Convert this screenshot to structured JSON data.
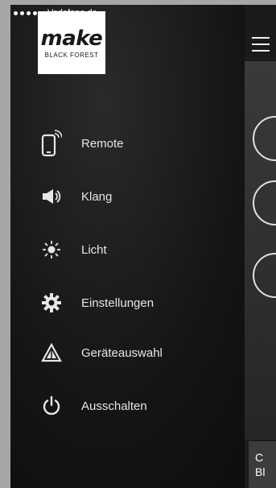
{
  "status_bar": {
    "carrier": "Vodafone.de"
  },
  "logo": {
    "word": "make",
    "subtitle": "BLACK FOREST"
  },
  "menu": {
    "items": [
      {
        "label": "Remote",
        "icon": "smartphone-icon"
      },
      {
        "label": "Klang",
        "icon": "speaker-icon"
      },
      {
        "label": "Licht",
        "icon": "light-icon"
      },
      {
        "label": "Einstellungen",
        "icon": "gear-icon"
      },
      {
        "label": "Geräteauswahl",
        "icon": "device-select-icon"
      },
      {
        "label": "Ausschalten",
        "icon": "power-icon"
      }
    ]
  },
  "content": {
    "bottom_button": {
      "line1": "C",
      "line2": "Bl"
    }
  },
  "colors": {
    "background": "#121212",
    "menu_text": "#e6e6e6",
    "logo_bg": "#ffffff",
    "bottom_button_bg": "#3c3c3c"
  }
}
